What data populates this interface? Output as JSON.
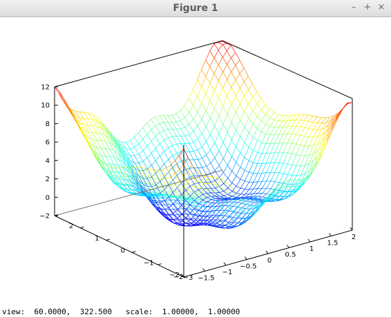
{
  "window": {
    "title": "Figure 1",
    "buttons": {
      "minimize": "–",
      "maximize": "+",
      "close": "×"
    }
  },
  "status": {
    "text": "view:  60.0000,  322.500   scale:  1.00000,  1.00000"
  },
  "chart_data": {
    "type": "surface",
    "style": "mesh wireframe, jet colormap by z",
    "z_ticks": [
      "−2",
      "0",
      "2",
      "4",
      "6",
      "8",
      "10",
      "12"
    ],
    "x_ticks": [
      "2",
      "1",
      "0",
      "−1",
      "−2",
      "−3"
    ],
    "y_ticks": [
      "−2",
      "−1.5",
      "−1",
      "−0.5",
      "0",
      "0.5",
      "1",
      "1.5",
      "2"
    ],
    "x_range": [
      -3,
      3
    ],
    "y_range": [
      -2,
      2
    ],
    "z_range": [
      -2,
      12
    ],
    "view": {
      "rot_x": 60,
      "rot_z": 322.5
    },
    "colormap": [
      "#0000ff",
      "#00ffff",
      "#ffff00",
      "#ff0000"
    ]
  }
}
